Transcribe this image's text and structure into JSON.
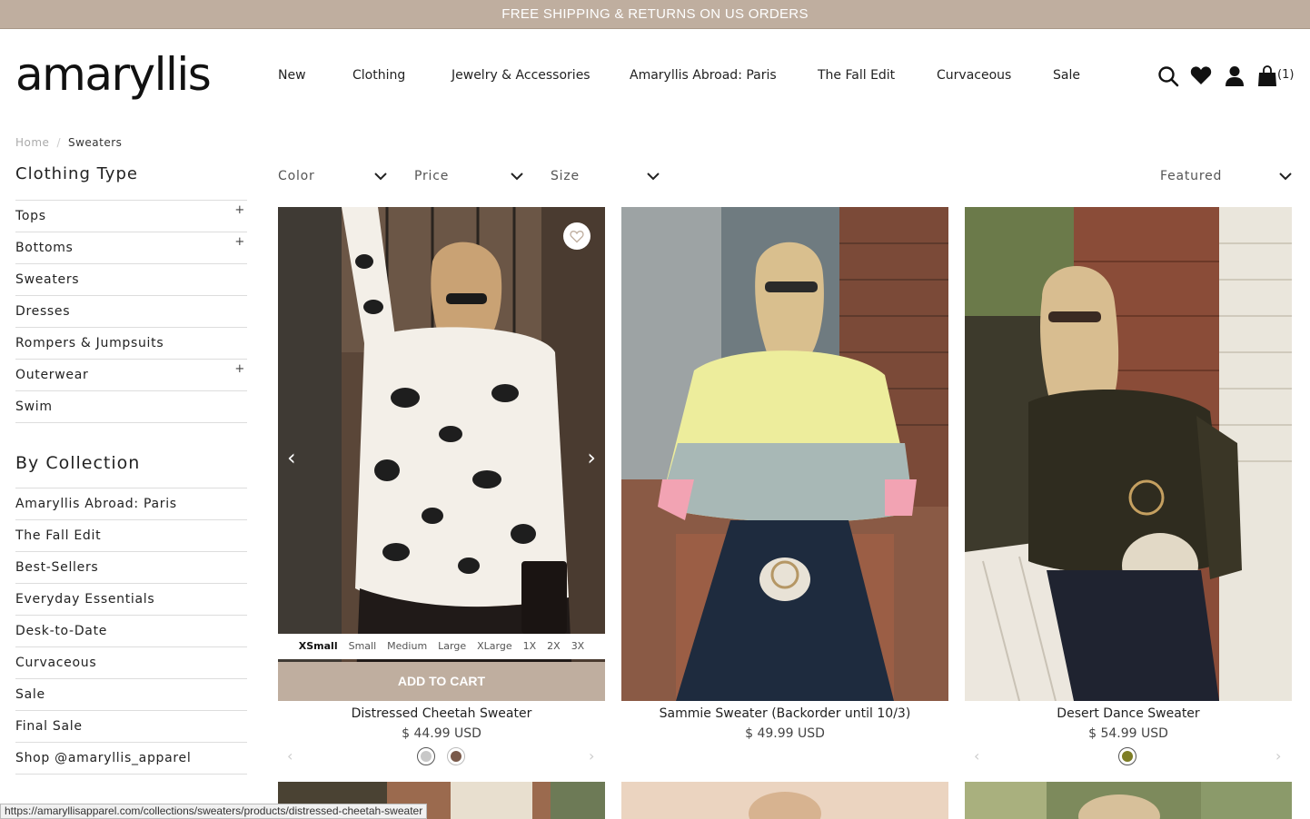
{
  "promo": "FREE SHIPPING & RETURNS ON US ORDERS",
  "logo": "amaryllis",
  "nav": [
    "New",
    "Clothing",
    "Jewelry & Accessories",
    "Amaryllis Abroad: Paris",
    "The Fall Edit",
    "Curvaceous",
    "Sale"
  ],
  "header": {
    "icons": [
      "search-icon",
      "heart-icon",
      "account-icon",
      "shopping-bag-icon"
    ],
    "cart_count": "(1)"
  },
  "breadcrumb": {
    "home": "Home",
    "separator": "/",
    "current": "Sweaters"
  },
  "sidebar": {
    "clothing_type": {
      "title": "Clothing Type",
      "items": [
        {
          "label": "Tops",
          "expand": "+"
        },
        {
          "label": "Bottoms",
          "expand": "+"
        },
        {
          "label": "Sweaters",
          "expand": ""
        },
        {
          "label": "Dresses",
          "expand": ""
        },
        {
          "label": "Rompers & Jumpsuits",
          "expand": ""
        },
        {
          "label": "Outerwear",
          "expand": "+"
        },
        {
          "label": "Swim",
          "expand": ""
        }
      ]
    },
    "collection": {
      "title": "By Collection",
      "items": [
        "Amaryllis Abroad: Paris",
        "The Fall Edit",
        "Best-Sellers",
        "Everyday Essentials",
        "Desk-to-Date",
        "Curvaceous",
        "Sale",
        "Final Sale",
        "Shop @amaryllis_apparel"
      ]
    }
  },
  "filters": {
    "color": "Color",
    "price": "Price",
    "size": "Size",
    "sort": "Featured"
  },
  "products": [
    {
      "name": "Distressed Cheetah Sweater",
      "price": "$ 44.99 USD",
      "sizes": [
        "XSmall",
        "Small",
        "Medium",
        "Large",
        "XLarge",
        "1X",
        "2X",
        "3X"
      ],
      "selected_size": "XSmall",
      "add_to_cart": "ADD TO CART",
      "swatches": [
        "#c8c8c8",
        "#7a5a4a"
      ]
    },
    {
      "name": "Sammie Sweater (Backorder until 10/3)",
      "price": "$ 49.99 USD",
      "swatches": []
    },
    {
      "name": "Desert Dance Sweater",
      "price": "$ 54.99 USD",
      "swatches": [
        "#7d7d25"
      ]
    }
  ],
  "status_url": "https://amaryllisapparel.com/collections/sweaters/products/distressed-cheetah-sweater",
  "colors": {
    "accent": "#bfae9f"
  }
}
